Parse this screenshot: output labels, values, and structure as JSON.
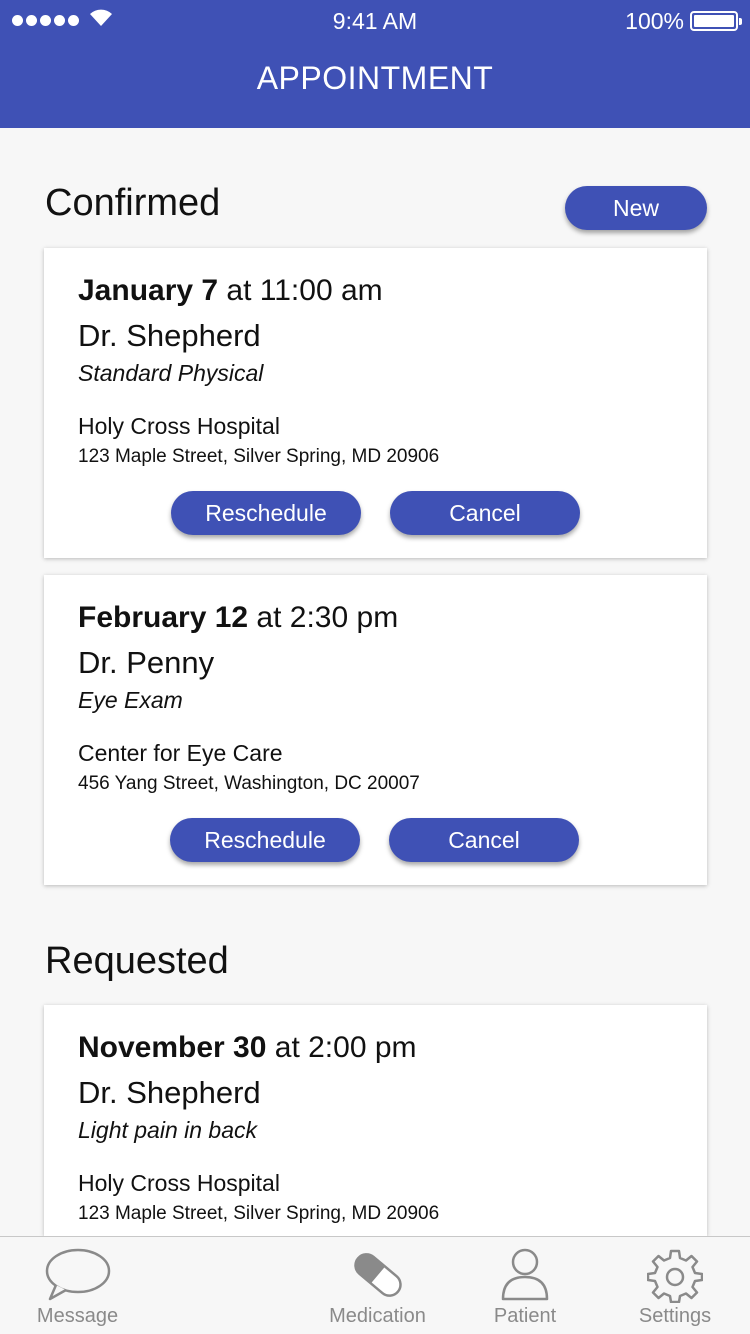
{
  "status_bar": {
    "time": "9:41 AM",
    "battery": "100%"
  },
  "header": {
    "title": "APPOINTMENT"
  },
  "confirmed": {
    "title": "Confirmed",
    "new_label": "New",
    "appointments": [
      {
        "date_bold": "January 7",
        "time": " at 11:00 am",
        "doctor": "Dr. Shepherd",
        "reason": "Standard Physical",
        "place": "Holy Cross Hospital",
        "address": "123 Maple Street, Silver Spring, MD 20906",
        "reschedule_label": "Reschedule",
        "cancel_label": "Cancel"
      },
      {
        "date_bold": "February 12",
        "time": " at 2:30 pm",
        "doctor": "Dr. Penny",
        "reason": "Eye Exam",
        "place": "Center for Eye Care",
        "address": "456 Yang Street, Washington, DC 20007",
        "reschedule_label": "Reschedule",
        "cancel_label": "Cancel"
      }
    ]
  },
  "requested": {
    "title": "Requested",
    "appointments": [
      {
        "date_bold": "November 30",
        "time": " at 2:00 pm",
        "doctor": "Dr. Shepherd",
        "reason": "Light pain in back",
        "place": "Holy Cross Hospital",
        "address": "123 Maple Street, Silver Spring, MD 20906"
      }
    ]
  },
  "tabs": [
    {
      "label": "Message",
      "icon": "message-icon"
    },
    {
      "label": "Medication",
      "icon": "pill-icon"
    },
    {
      "label": "Patient",
      "icon": "person-icon"
    },
    {
      "label": "Settings",
      "icon": "gear-icon"
    }
  ],
  "colors": {
    "accent": "#3f51b5",
    "tab_inactive": "#8a8a8a",
    "background": "#f7f7f7"
  }
}
